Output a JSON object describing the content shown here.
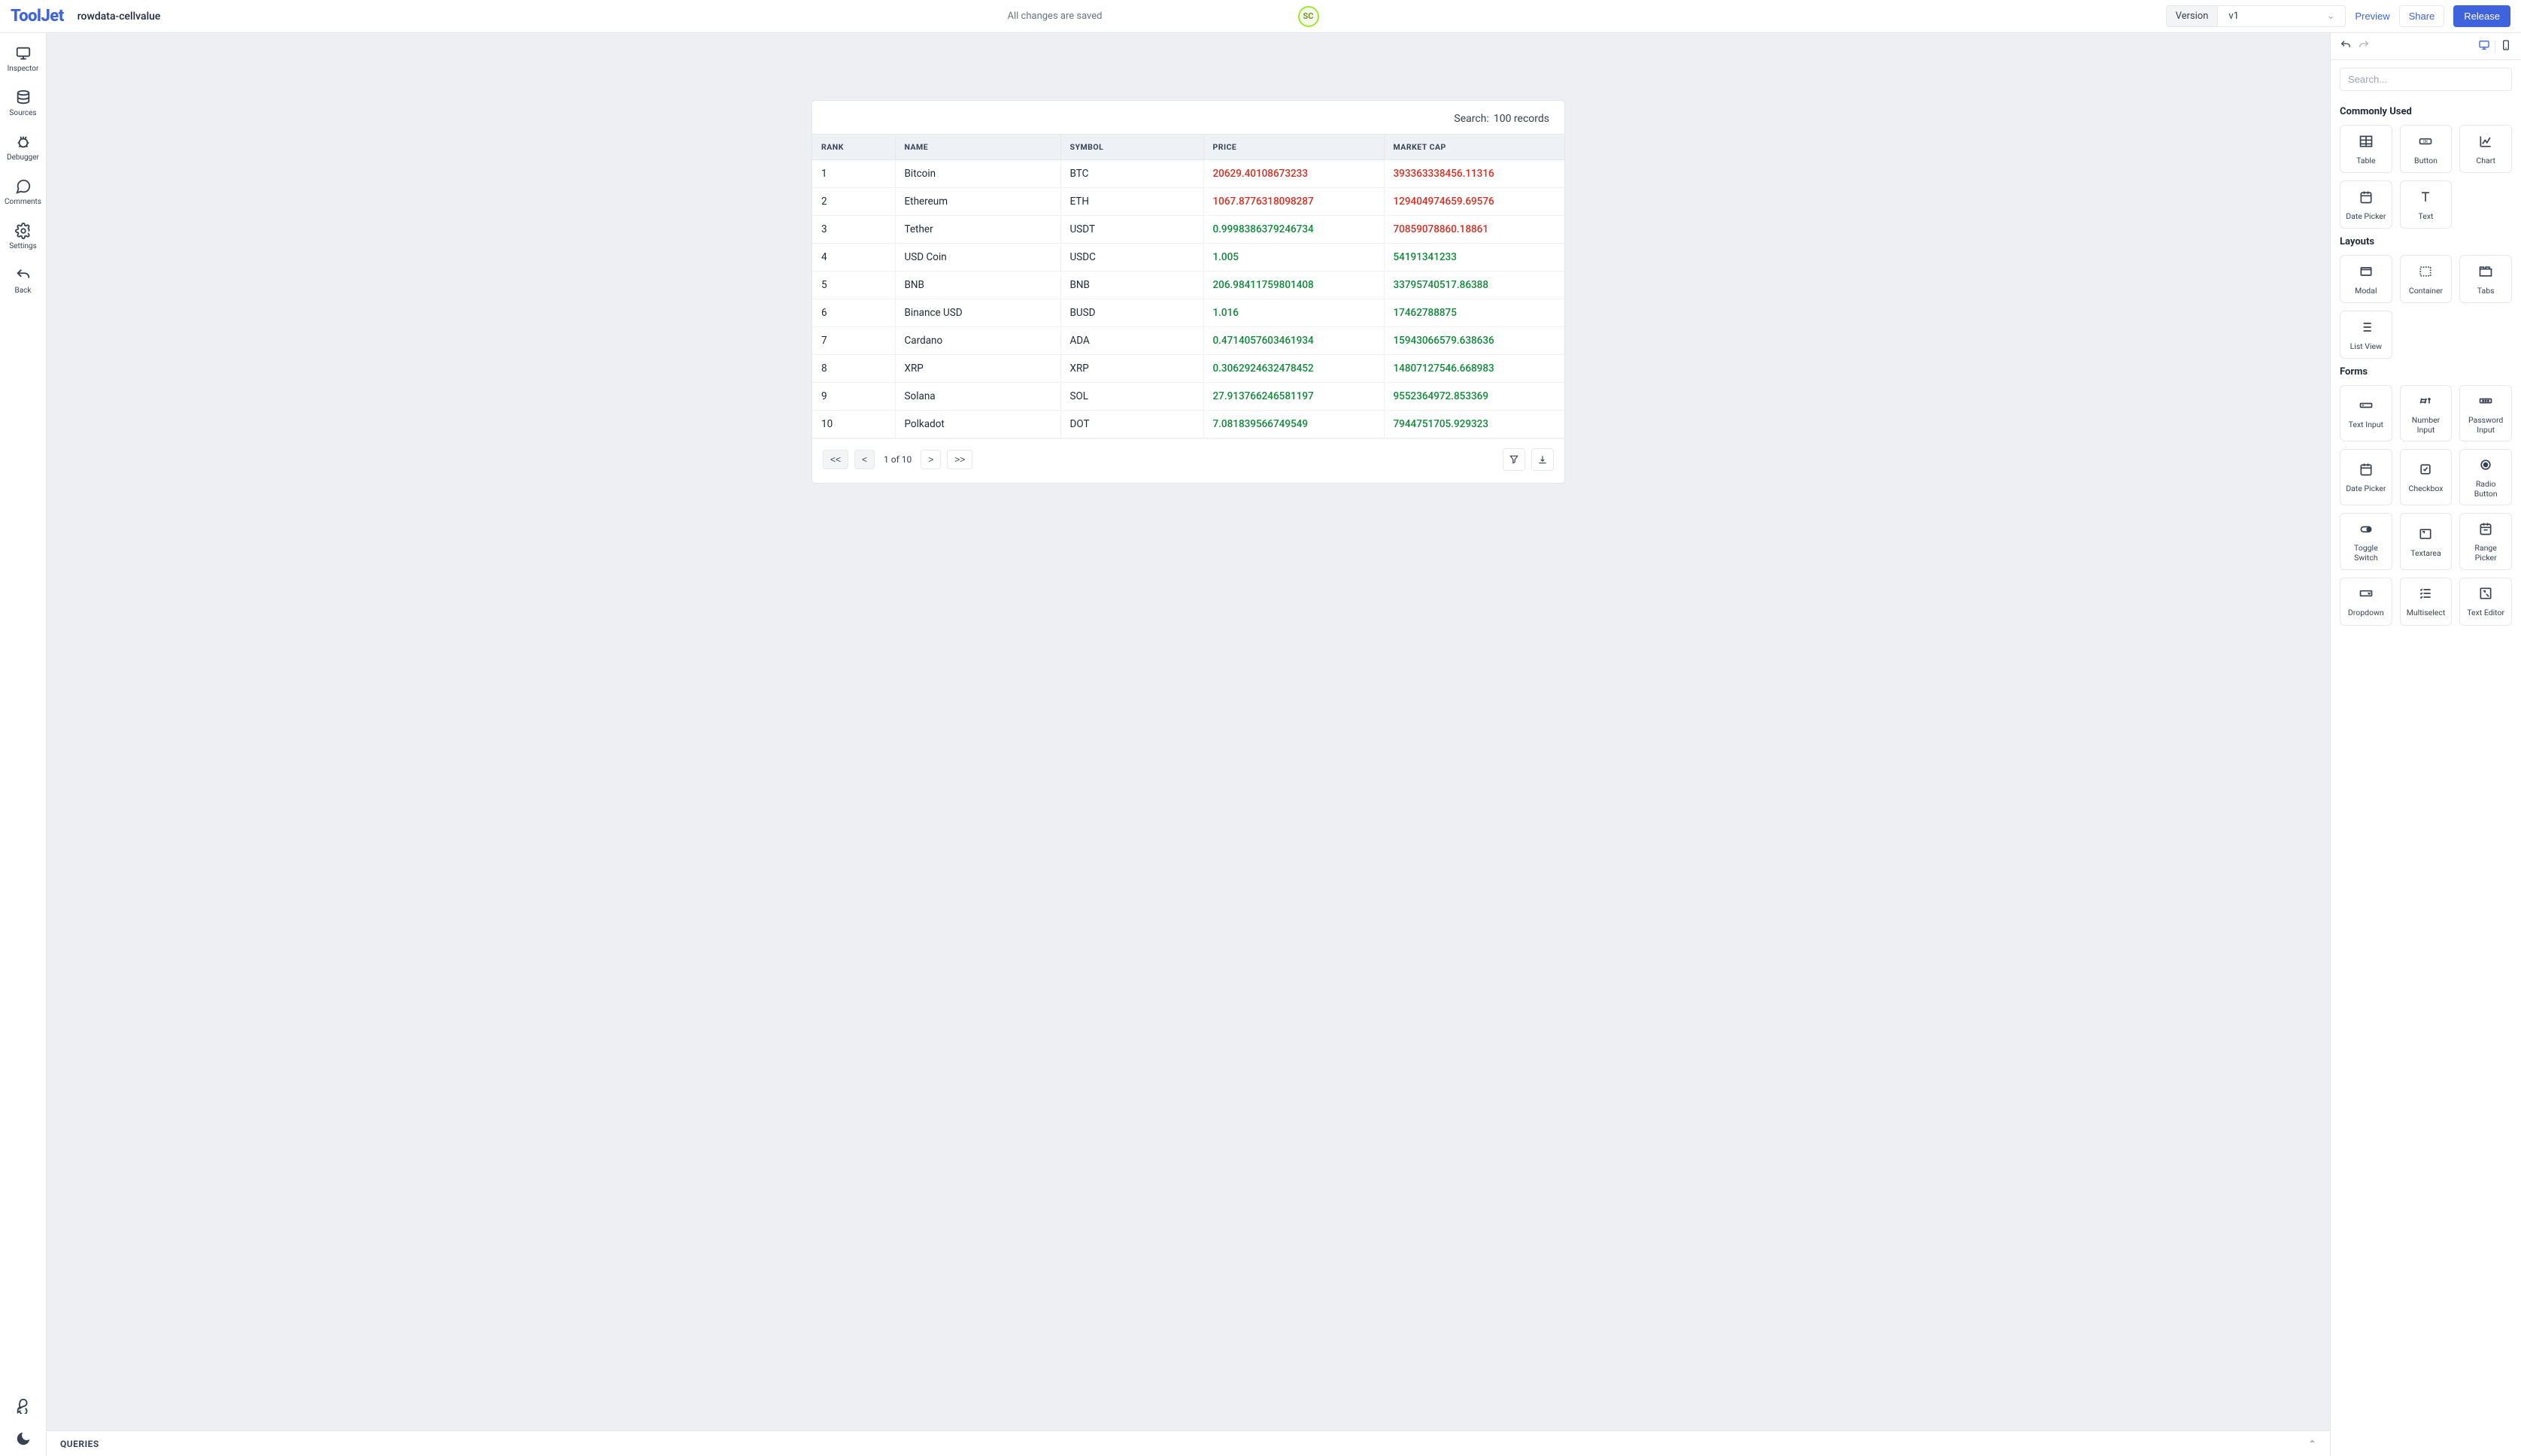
{
  "header": {
    "logo_text": "ToolJet",
    "app_name": "rowdata-cellvalue",
    "saved_status": "All changes are saved",
    "avatar_initials": "SC",
    "version_label": "Version",
    "version_value": "v1",
    "preview": "Preview",
    "share": "Share",
    "release": "Release"
  },
  "leftnav": {
    "inspector": "Inspector",
    "sources": "Sources",
    "debugger": "Debugger",
    "comments": "Comments",
    "settings": "Settings",
    "back": "Back"
  },
  "table": {
    "search_label": "Search:",
    "search_value": "100 records",
    "columns": [
      "RANK",
      "NAME",
      "SYMBOL",
      "PRICE",
      "MARKET CAP"
    ],
    "rows": [
      {
        "rank": "1",
        "name": "Bitcoin",
        "symbol": "BTC",
        "price": "20629.40108673233",
        "market_cap": "393363338456.11316",
        "price_cls": "num-red",
        "mc_cls": "num-red"
      },
      {
        "rank": "2",
        "name": "Ethereum",
        "symbol": "ETH",
        "price": "1067.8776318098287",
        "market_cap": "129404974659.69576",
        "price_cls": "num-red",
        "mc_cls": "num-red"
      },
      {
        "rank": "3",
        "name": "Tether",
        "symbol": "USDT",
        "price": "0.9998386379246734",
        "market_cap": "70859078860.18861",
        "price_cls": "num-green",
        "mc_cls": "num-red"
      },
      {
        "rank": "4",
        "name": "USD Coin",
        "symbol": "USDC",
        "price": "1.005",
        "market_cap": "54191341233",
        "price_cls": "num-green",
        "mc_cls": "num-green"
      },
      {
        "rank": "5",
        "name": "BNB",
        "symbol": "BNB",
        "price": "206.98411759801408",
        "market_cap": "33795740517.86388",
        "price_cls": "num-green",
        "mc_cls": "num-green"
      },
      {
        "rank": "6",
        "name": "Binance USD",
        "symbol": "BUSD",
        "price": "1.016",
        "market_cap": "17462788875",
        "price_cls": "num-green",
        "mc_cls": "num-green"
      },
      {
        "rank": "7",
        "name": "Cardano",
        "symbol": "ADA",
        "price": "0.4714057603461934",
        "market_cap": "15943066579.638636",
        "price_cls": "num-green",
        "mc_cls": "num-green"
      },
      {
        "rank": "8",
        "name": "XRP",
        "symbol": "XRP",
        "price": "0.3062924632478452",
        "market_cap": "14807127546.668983",
        "price_cls": "num-green",
        "mc_cls": "num-green"
      },
      {
        "rank": "9",
        "name": "Solana",
        "symbol": "SOL",
        "price": "27.913766246581197",
        "market_cap": "9552364972.853369",
        "price_cls": "num-green",
        "mc_cls": "num-green"
      },
      {
        "rank": "10",
        "name": "Polkadot",
        "symbol": "DOT",
        "price": "7.081839566749549",
        "market_cap": "7944751705.929323",
        "price_cls": "num-green",
        "mc_cls": "num-green"
      }
    ],
    "pagination": {
      "first": "<<",
      "prev": "<",
      "info": "1 of 10",
      "next": ">",
      "last": ">>"
    }
  },
  "queries": {
    "title": "QUERIES"
  },
  "rightpanel": {
    "search_placeholder": "Search...",
    "sections": {
      "commonly_used": {
        "title": "Commonly Used",
        "items": [
          "Table",
          "Button",
          "Chart",
          "Date Picker",
          "Text"
        ]
      },
      "layouts": {
        "title": "Layouts",
        "items": [
          "Modal",
          "Container",
          "Tabs",
          "List View"
        ]
      },
      "forms": {
        "title": "Forms",
        "items": [
          "Text Input",
          "Number Input",
          "Password Input",
          "Date Picker",
          "Checkbox",
          "Radio Button",
          "Toggle Switch",
          "Textarea",
          "Range Picker",
          "Dropdown",
          "Multiselect",
          "Text Editor"
        ]
      }
    }
  }
}
